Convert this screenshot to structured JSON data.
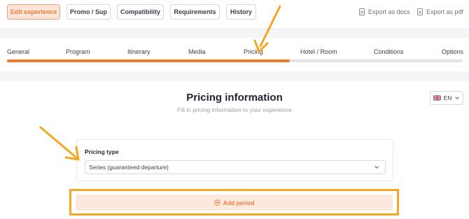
{
  "toolbar": {
    "buttons": [
      {
        "label": "Edit experience",
        "active": true
      },
      {
        "label": "Promo / Sup",
        "active": false
      },
      {
        "label": "Compatibility",
        "active": false
      },
      {
        "label": "Requirements",
        "active": false
      },
      {
        "label": "History",
        "active": false
      }
    ],
    "export_docx": "Export as docx",
    "export_pdf": "Export as pdf"
  },
  "tabs": {
    "items": [
      "General",
      "Program",
      "Itinerary",
      "Media",
      "Pricing",
      "Hotel / Room",
      "Conditions",
      "Options"
    ],
    "active": "Pricing",
    "progress_percent": 62
  },
  "main": {
    "title": "Pricing information",
    "subtitle": "Fill in pricing information to your experience",
    "language": "EN",
    "pricing_type_label": "Pricing type",
    "pricing_type_value": "Series (guaranteed departure)",
    "add_period_label": "Add period"
  },
  "colors": {
    "accent": "#f07a28",
    "annotation": "#f5a623"
  }
}
